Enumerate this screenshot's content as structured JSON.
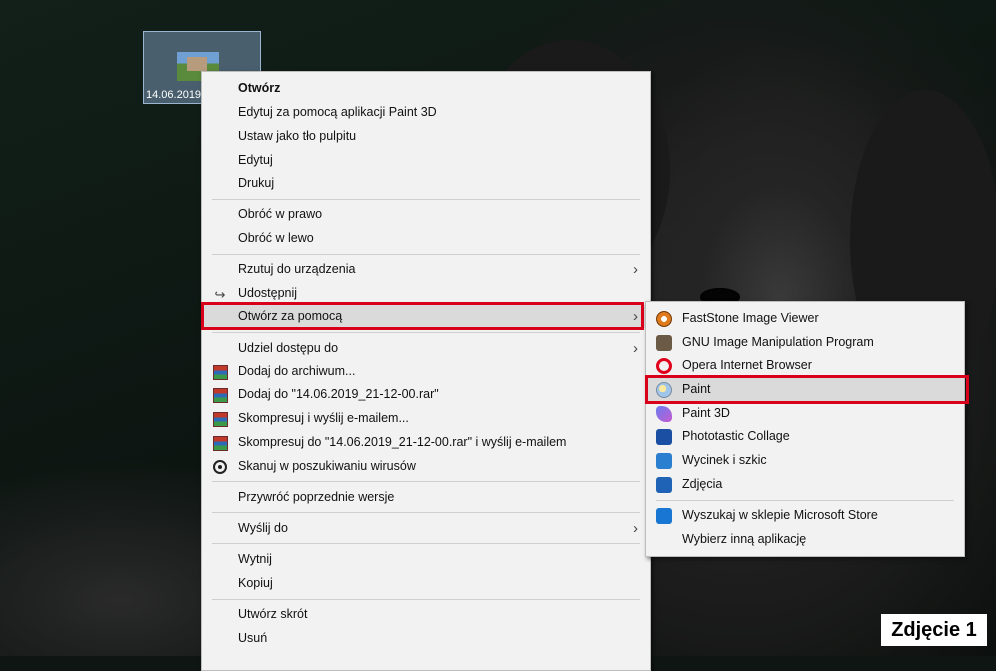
{
  "desktop": {
    "file_name": "14.06.2019"
  },
  "context_menu": {
    "items": [
      {
        "label": "Otwórz"
      },
      {
        "label": "Edytuj za pomocą aplikacji Paint 3D"
      },
      {
        "label": "Ustaw jako tło pulpitu"
      },
      {
        "label": "Edytuj"
      },
      {
        "label": "Drukuj"
      },
      {
        "label": "Obróć w prawo"
      },
      {
        "label": "Obróć w lewo"
      },
      {
        "label": "Rzutuj do urządzenia"
      },
      {
        "label": "Udostępnij"
      },
      {
        "label": "Otwórz za pomocą"
      },
      {
        "label": "Udziel dostępu do"
      },
      {
        "label": "Dodaj do archiwum..."
      },
      {
        "label": "Dodaj do \"14.06.2019_21-12-00.rar\""
      },
      {
        "label": "Skompresuj i wyślij e-mailem..."
      },
      {
        "label": "Skompresuj do \"14.06.2019_21-12-00.rar\" i wyślij e-mailem"
      },
      {
        "label": "Skanuj w poszukiwaniu wirusów"
      },
      {
        "label": "Przywróć poprzednie wersje"
      },
      {
        "label": "Wyślij do"
      },
      {
        "label": "Wytnij"
      },
      {
        "label": "Kopiuj"
      },
      {
        "label": "Utwórz skrót"
      },
      {
        "label": "Usuń"
      }
    ]
  },
  "submenu": {
    "items": [
      {
        "label": "FastStone Image Viewer"
      },
      {
        "label": "GNU Image Manipulation Program"
      },
      {
        "label": "Opera Internet Browser"
      },
      {
        "label": "Paint"
      },
      {
        "label": "Paint 3D"
      },
      {
        "label": "Phototastic Collage"
      },
      {
        "label": "Wycinek i szkic"
      },
      {
        "label": "Zdjęcia"
      },
      {
        "label": "Wyszukaj w sklepie Microsoft Store"
      },
      {
        "label": "Wybierz inną aplikację"
      }
    ]
  },
  "caption": "Zdjęcie 1",
  "colors": {
    "highlight": "#d9001b",
    "menu_background": "#f2f2f2",
    "hover_background": "#dadada"
  }
}
